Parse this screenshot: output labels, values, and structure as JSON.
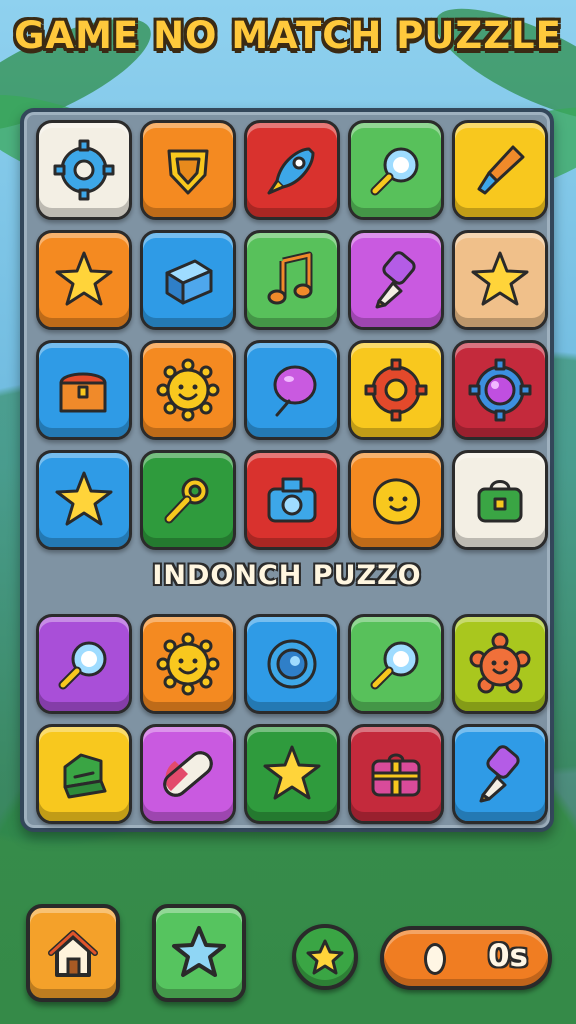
{
  "title": "GAME NO MATCH PUZZLE",
  "subtitle": "INDONCH PUZZO",
  "score_display": "0s",
  "colors": {
    "white": "#f3efe4",
    "orange": "#f48a21",
    "red": "#d9322e",
    "green": "#58c15b",
    "yellow": "#f8c81e",
    "blue": "#2f9be6",
    "magenta": "#c95ae0",
    "peach": "#f0c08a",
    "crimson": "#c42a3c",
    "darkgreen": "#2f9b3d",
    "lime": "#a9c71e",
    "purple": "#a94fd8"
  },
  "board_top": [
    {
      "icon": "gear-icon",
      "color": "white"
    },
    {
      "icon": "shield-badge-icon",
      "color": "orange"
    },
    {
      "icon": "rocket-icon",
      "color": "red"
    },
    {
      "icon": "magnifier-icon",
      "color": "green"
    },
    {
      "icon": "paintbrush-icon",
      "color": "yellow"
    },
    {
      "icon": "star-icon",
      "color": "orange"
    },
    {
      "icon": "block-cube-icon",
      "color": "blue"
    },
    {
      "icon": "music-note-icon",
      "color": "green"
    },
    {
      "icon": "brush-tool-icon",
      "color": "magenta"
    },
    {
      "icon": "star-icon",
      "color": "peach"
    },
    {
      "icon": "treasure-chest-icon",
      "color": "blue"
    },
    {
      "icon": "smiling-sun-icon",
      "color": "orange"
    },
    {
      "icon": "balloon-icon",
      "color": "blue"
    },
    {
      "icon": "gear-ring-icon",
      "color": "yellow"
    },
    {
      "icon": "gem-gear-icon",
      "color": "crimson"
    },
    {
      "icon": "star-icon",
      "color": "blue"
    },
    {
      "icon": "key-icon",
      "color": "darkgreen"
    },
    {
      "icon": "camera-icon",
      "color": "red"
    },
    {
      "icon": "smiling-blob-icon",
      "color": "orange"
    },
    {
      "icon": "lunchbox-icon",
      "color": "white"
    }
  ],
  "board_bottom": [
    {
      "icon": "magnifier-icon",
      "color": "purple"
    },
    {
      "icon": "smiling-sun-icon",
      "color": "orange"
    },
    {
      "icon": "ring-icon",
      "color": "blue"
    },
    {
      "icon": "magnifier-icon",
      "color": "green"
    },
    {
      "icon": "smiling-flower-icon",
      "color": "lime"
    },
    {
      "icon": "green-sofa-icon",
      "color": "yellow"
    },
    {
      "icon": "pill-capsule-icon",
      "color": "magenta"
    },
    {
      "icon": "star-icon",
      "color": "darkgreen"
    },
    {
      "icon": "gift-box-icon",
      "color": "crimson"
    },
    {
      "icon": "brush-tool-icon",
      "color": "blue"
    }
  ],
  "buttons": [
    {
      "name": "home-button",
      "icon": "home-icon"
    },
    {
      "name": "star-button",
      "icon": "star-icon"
    }
  ]
}
